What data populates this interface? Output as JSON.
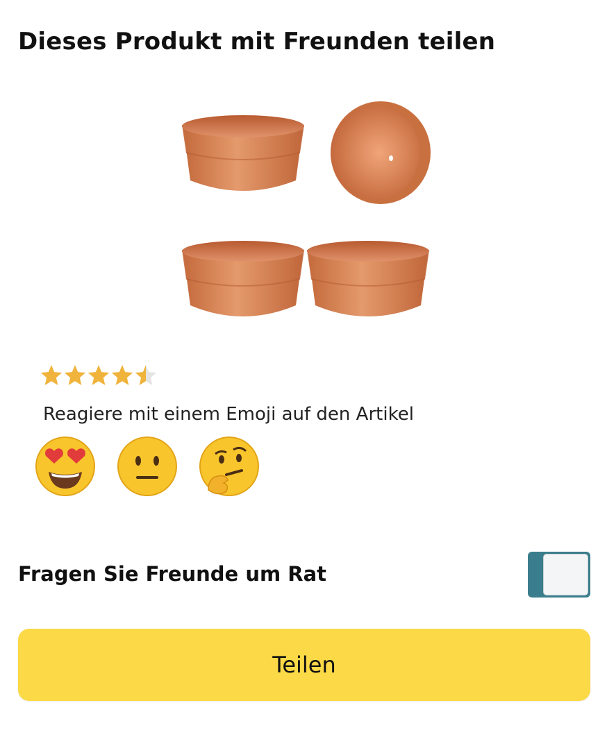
{
  "header": {
    "title": "Dieses Produkt mit Freunden teilen"
  },
  "product": {
    "image_icon": "terracotta-pots-image",
    "rating": 4.5,
    "rating_max": 5,
    "star_color": "#f0b33b"
  },
  "reaction": {
    "prompt": "Reagiere mit einem Emoji auf den Artikel",
    "emojis": [
      {
        "icon": "heart-eyes-emoji",
        "glyph": "😍"
      },
      {
        "icon": "neutral-face-emoji",
        "glyph": "😐"
      },
      {
        "icon": "thinking-face-emoji",
        "glyph": "🤔"
      }
    ]
  },
  "ask_friends": {
    "label": "Fragen Sie Freunde um Rat",
    "toggle_on": false,
    "toggle_color": "#3a7d8c"
  },
  "share": {
    "button_label": "Teilen",
    "button_color": "#fbd947"
  }
}
